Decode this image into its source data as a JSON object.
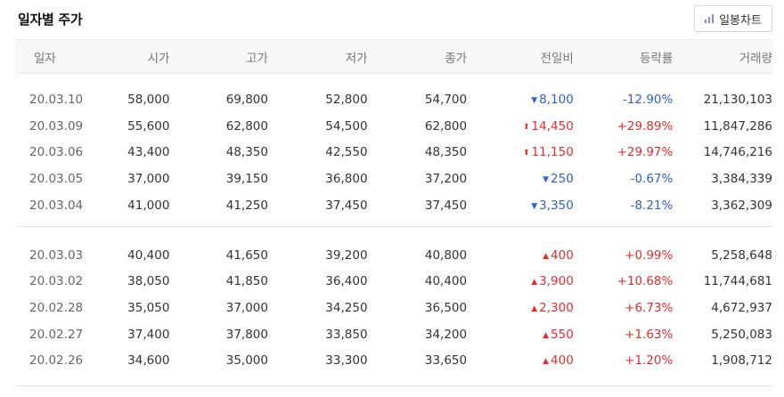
{
  "title": "일자별 주가",
  "chart_button": {
    "label": "일봉차트",
    "icon": "bar-chart-icon"
  },
  "columns": [
    "일자",
    "시가",
    "고가",
    "저가",
    "종가",
    "전일비",
    "등락률",
    "거래량"
  ],
  "colors": {
    "up": "#e42c2c",
    "down": "#2c5fd8"
  },
  "groups": [
    {
      "rows": [
        {
          "date": "20.03.10",
          "open": "58,000",
          "high": "69,800",
          "low": "52,800",
          "close": "54,700",
          "dir": "down",
          "arrow": "▼",
          "change": "8,100",
          "rate": "-12.90%",
          "volume": "21,130,103"
        },
        {
          "date": "20.03.09",
          "open": "55,600",
          "high": "62,800",
          "low": "54,500",
          "close": "62,800",
          "dir": "up",
          "arrow": "⬆",
          "change": "14,450",
          "rate": "+29.89%",
          "volume": "11,847,286"
        },
        {
          "date": "20.03.06",
          "open": "43,400",
          "high": "48,350",
          "low": "42,550",
          "close": "48,350",
          "dir": "up",
          "arrow": "⬆",
          "change": "11,150",
          "rate": "+29.97%",
          "volume": "14,746,216"
        },
        {
          "date": "20.03.05",
          "open": "37,000",
          "high": "39,150",
          "low": "36,800",
          "close": "37,200",
          "dir": "down",
          "arrow": "▼",
          "change": "250",
          "rate": "-0.67%",
          "volume": "3,384,339"
        },
        {
          "date": "20.03.04",
          "open": "41,000",
          "high": "41,250",
          "low": "37,450",
          "close": "37,450",
          "dir": "down",
          "arrow": "▼",
          "change": "3,350",
          "rate": "-8.21%",
          "volume": "3,362,309"
        }
      ]
    },
    {
      "rows": [
        {
          "date": "20.03.03",
          "open": "40,400",
          "high": "41,650",
          "low": "39,200",
          "close": "40,800",
          "dir": "up",
          "arrow": "▲",
          "change": "400",
          "rate": "+0.99%",
          "volume": "5,258,648"
        },
        {
          "date": "20.03.02",
          "open": "38,050",
          "high": "41,850",
          "low": "36,400",
          "close": "40,400",
          "dir": "up",
          "arrow": "▲",
          "change": "3,900",
          "rate": "+10.68%",
          "volume": "11,744,681"
        },
        {
          "date": "20.02.28",
          "open": "35,050",
          "high": "37,000",
          "low": "34,250",
          "close": "36,500",
          "dir": "up",
          "arrow": "▲",
          "change": "2,300",
          "rate": "+6.73%",
          "volume": "4,672,937"
        },
        {
          "date": "20.02.27",
          "open": "37,400",
          "high": "37,800",
          "low": "33,850",
          "close": "34,200",
          "dir": "up",
          "arrow": "▲",
          "change": "550",
          "rate": "+1.63%",
          "volume": "5,250,083"
        },
        {
          "date": "20.02.26",
          "open": "34,600",
          "high": "35,000",
          "low": "33,300",
          "close": "33,650",
          "dir": "up",
          "arrow": "▲",
          "change": "400",
          "rate": "+1.20%",
          "volume": "1,908,712"
        }
      ]
    }
  ]
}
